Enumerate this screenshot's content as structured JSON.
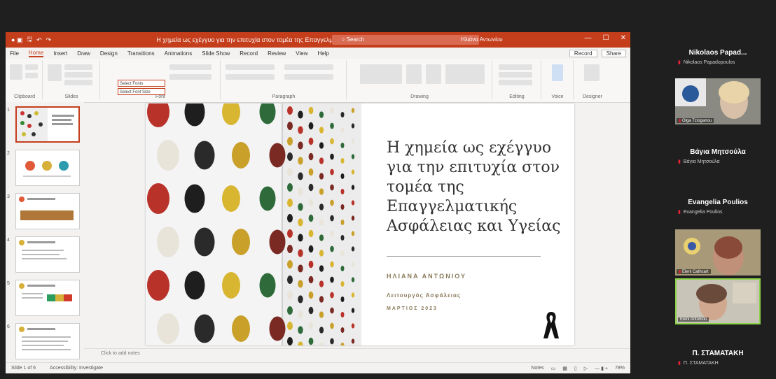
{
  "powerpoint": {
    "title_bar": {
      "document_title": "Η χημεία ως εχέγγυο για την επιτυχία στον τομέα της Επαγγελματικής Ασφάλειας και Υγείας",
      "search_placeholder": "Search",
      "user": "Ηλιάνα Αντωνίου"
    },
    "menu_tabs": [
      "File",
      "Home",
      "Insert",
      "Draw",
      "Design",
      "Transitions",
      "Animations",
      "Slide Show",
      "Record",
      "Review",
      "View",
      "Help"
    ],
    "active_tab": "Home",
    "menu_right": [
      "Record",
      "Share"
    ],
    "ribbon": {
      "groups": [
        "Clipboard",
        "Slides",
        "Font",
        "Paragraph",
        "Drawing",
        "Editing",
        "Voice",
        "Designer"
      ],
      "font_name": "Select Fonts",
      "font_size": "Select Font Size"
    },
    "slide_count": 6,
    "slide": {
      "title": "Η χημεία ως εχέγγυο για την επιτυχία στον τομέα της Επαγγελματικής Ασφάλειας και Υγείας",
      "author": "ΗΛΙΑΝΑ ΑΝΤΩΝΙΟΥ",
      "role": "Λειτουργός Ασφάλειας",
      "date": "ΜΑΡΤΙΟΣ 2023"
    },
    "notes_placeholder": "Click to add notes",
    "status": {
      "slide": "Slide 1 of 6",
      "accessibility": "Accessibility: Investigate",
      "notes": "Notes",
      "zoom": "78%"
    }
  },
  "participants": [
    {
      "name": "Nikolaos Papad...",
      "sub": "Nikolaos Papadopoulos",
      "has_video": false
    },
    {
      "name": "",
      "sub": "",
      "has_video": true,
      "video_label": "Olga Tzioganou"
    },
    {
      "name": "Βάγια Μητσούλα",
      "sub": "Βάγια Μητσούλα",
      "has_video": false
    },
    {
      "name": "Evangelia Poulios",
      "sub": "Evangelia Poulios",
      "has_video": false
    },
    {
      "name": "",
      "sub": "",
      "has_video": true,
      "video_label": "Eleni Cathcart"
    },
    {
      "name": "",
      "sub": "",
      "has_video": true,
      "video_label": "Eleni Antoniou",
      "active": true
    },
    {
      "name": "Π. ΣΤΑΜΑΤΑΚΗ",
      "sub": "Π. ΣΤΑΜΑΤΑΚΗ",
      "has_video": false
    }
  ],
  "colors": {
    "accent": "#c43e1c",
    "active_speaker": "#8bd34a",
    "text_gold": "#8a7a5a"
  }
}
